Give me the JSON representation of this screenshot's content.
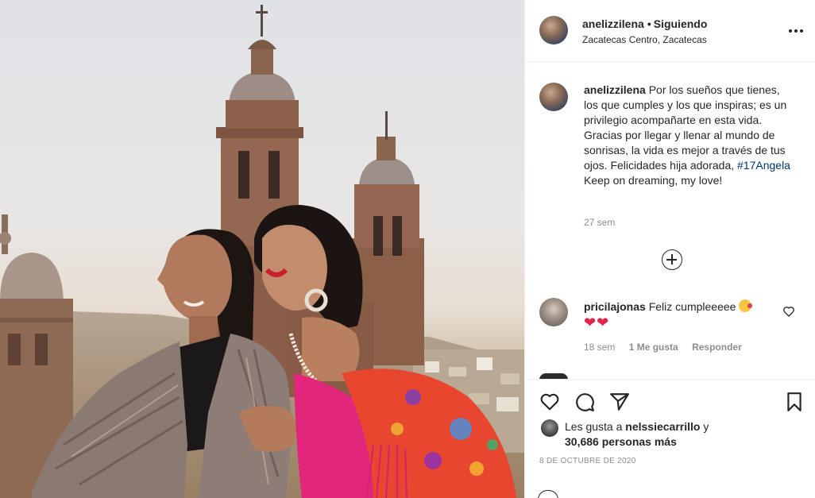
{
  "header": {
    "username": "anelizzilena",
    "separator": "•",
    "follow_status": "Siguiendo",
    "location": "Zacatecas Centro, Zacatecas"
  },
  "caption": {
    "username": "anelizzilena",
    "text_before_tag": "Por los sueños que tienes, los que cumples y los que inspiras; es un privilegio acompañarte en esta vida. Gracias por llegar y llenar al mundo de sonrisas, la vida es mejor a través de tus ojos. Felicidades hija adorada,",
    "hashtag": "#17Angela",
    "text_after_tag": "Keep on dreaming, my love!",
    "time": "27 sem"
  },
  "comments": [
    {
      "username": "pricilajonas",
      "text": "Feliz cumpleeeee",
      "time": "18 sem",
      "likes": "1 Me gusta",
      "reply": "Responder"
    }
  ],
  "likes": {
    "prefix": "Les gusta a",
    "user": "nelssiecarrillo",
    "conj": "y",
    "others": "30,686 personas más"
  },
  "date": "8 DE OCTUBRE DE 2020",
  "colors": {
    "text": "#262626",
    "muted": "#8e8e8e",
    "hashtag": "#00376b",
    "heart": "#e0244a"
  },
  "icons": [
    "more-icon",
    "add-comment-icon",
    "heart-icon",
    "comment-icon",
    "share-icon",
    "bookmark-icon"
  ]
}
